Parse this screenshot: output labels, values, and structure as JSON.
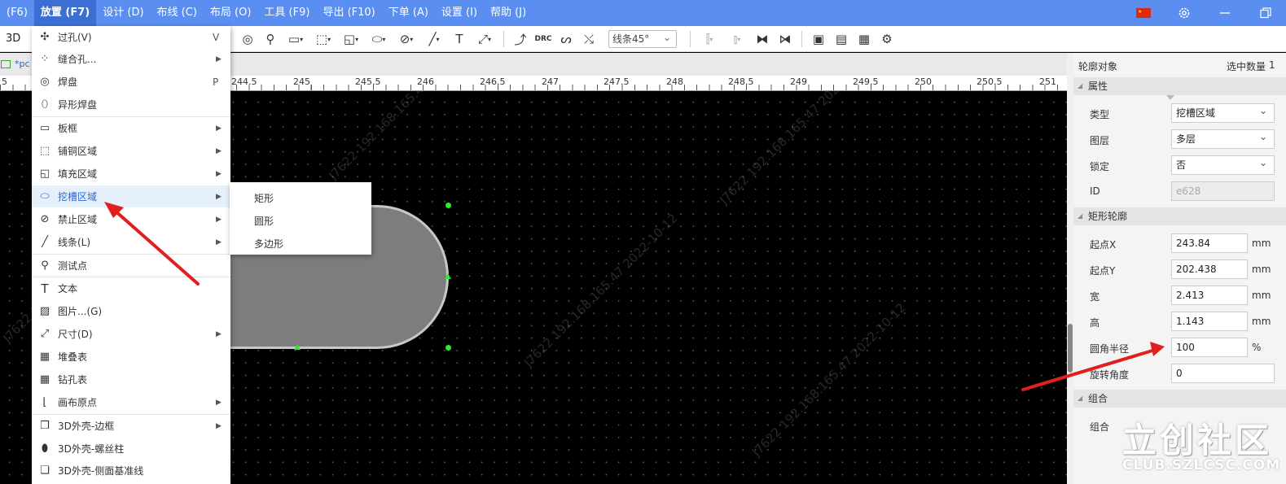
{
  "menubar": {
    "items": [
      "(F6)",
      "放置 (F7)",
      "设计 (D)",
      "布线 (C)",
      "布局 (O)",
      "工具 (F9)",
      "导出 (F10)",
      "下单 (A)",
      "设置 (I)",
      "帮助 (J)"
    ],
    "active_index": 1
  },
  "toolbar": {
    "view_3d": "3D",
    "drc": "DRC",
    "line_mode": "线条45°"
  },
  "tab": {
    "label": "*pc"
  },
  "ruler": {
    "labels": [
      "5",
      "244.5",
      "245",
      "245.5",
      "246",
      "246.5",
      "247",
      "247.5",
      "248",
      "248.5",
      "249",
      "249.5",
      "250",
      "250.5",
      "251"
    ]
  },
  "dropdown": {
    "items": [
      {
        "label": "过孔(V)",
        "key": "V",
        "submenu": false,
        "icon": "via-icon"
      },
      {
        "label": "缝合孔...",
        "key": "",
        "submenu": true,
        "icon": "stitch-via-icon"
      },
      {
        "label": "焊盘",
        "key": "P",
        "submenu": false,
        "icon": "pad-icon"
      },
      {
        "label": "异形焊盘",
        "key": "",
        "submenu": false,
        "icon": "custom-pad-icon"
      },
      {
        "label": "板框",
        "key": "",
        "submenu": true,
        "icon": "board-outline-icon"
      },
      {
        "label": "铺铜区域",
        "key": "",
        "submenu": true,
        "icon": "copper-area-icon"
      },
      {
        "label": "填充区域",
        "key": "",
        "submenu": true,
        "icon": "fill-area-icon"
      },
      {
        "label": "挖槽区域",
        "key": "",
        "submenu": true,
        "icon": "slot-area-icon",
        "highlighted": true
      },
      {
        "label": "禁止区域",
        "key": "",
        "submenu": true,
        "icon": "prohibited-area-icon"
      },
      {
        "label": "线条(L)",
        "key": "",
        "submenu": true,
        "icon": "line-icon"
      },
      {
        "label": "测试点",
        "key": "",
        "submenu": false,
        "icon": "test-point-icon"
      },
      {
        "label": "文本",
        "key": "",
        "submenu": false,
        "icon": "text-icon"
      },
      {
        "label": "图片...(G)",
        "key": "",
        "submenu": false,
        "icon": "image-icon"
      },
      {
        "label": "尺寸(D)",
        "key": "",
        "submenu": true,
        "icon": "dimension-icon"
      },
      {
        "label": "堆叠表",
        "key": "",
        "submenu": false,
        "icon": "stackup-table-icon"
      },
      {
        "label": "钻孔表",
        "key": "",
        "submenu": false,
        "icon": "drill-table-icon"
      },
      {
        "label": "画布原点",
        "key": "",
        "submenu": true,
        "icon": "canvas-origin-icon"
      },
      {
        "label": "3D外壳-边框",
        "key": "",
        "submenu": true,
        "icon": "3d-shell-border-icon"
      },
      {
        "label": "3D外壳-螺丝柱",
        "key": "",
        "submenu": false,
        "icon": "3d-shell-screw-icon"
      },
      {
        "label": "3D外壳-侧面基准线",
        "key": "",
        "submenu": false,
        "icon": "3d-shell-side-icon"
      }
    ]
  },
  "submenu": {
    "items": [
      "矩形",
      "圆形",
      "多边形"
    ]
  },
  "panel": {
    "title": "轮廓对象",
    "selected_count_label": "选中数量",
    "selected_count": "1",
    "section_attributes": "属性",
    "type_label": "类型",
    "type_value": "挖槽区域",
    "layer_label": "图层",
    "layer_value": "多层",
    "lock_label": "锁定",
    "lock_value": "否",
    "id_label": "ID",
    "id_value": "e628",
    "section_rect": "矩形轮廓",
    "start_x_label": "起点X",
    "start_x_value": "243.84",
    "start_y_label": "起点Y",
    "start_y_value": "202.438",
    "width_label": "宽",
    "width_value": "2.413",
    "height_label": "高",
    "height_value": "1.143",
    "radius_label": "圆角半径",
    "radius_value": "100",
    "rotation_label": "旋转角度",
    "rotation_value": "0",
    "unit_mm": "mm",
    "unit_pct": "%",
    "section_group": "组合",
    "group_label": "组合"
  },
  "watermark": {
    "logo": "立创社区",
    "logo_sub": "CLUB.SZLCSC.COM",
    "canvas_text": "J7622 192.168.165.47 2022-10-12"
  },
  "colors": {
    "menubar": "#5a8ef0",
    "menu_highlight": "#e6f0fb",
    "highlight_text": "#2a6bd1",
    "slot_fill": "#7d7d7d",
    "handle": "#2ee82e",
    "arrow": "#e02020"
  }
}
